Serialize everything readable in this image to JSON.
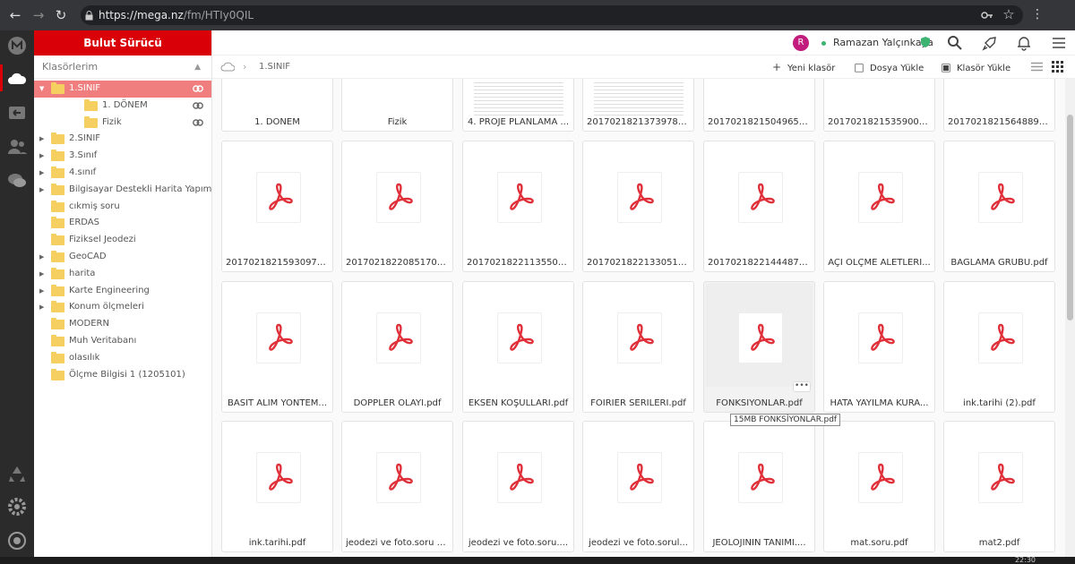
{
  "browser": {
    "url_host": "https://mega.nz",
    "url_path": "/fm/HTIy0QIL"
  },
  "sidebar": {
    "brand": "Bulut Sürücü",
    "tree_header": "Klasörlerim",
    "items": [
      {
        "label": "1.SINIF",
        "selected": true,
        "expanded": true,
        "level": 0,
        "has_link": true
      },
      {
        "label": "1. DÖNEM",
        "level": 1,
        "has_link": true
      },
      {
        "label": "Fizik",
        "level": 1,
        "has_link": true
      },
      {
        "label": "2.SINIF",
        "level": 0,
        "has_children": true
      },
      {
        "label": "3.Sınıf",
        "level": 0,
        "has_children": true
      },
      {
        "label": "4.sınıf",
        "level": 0,
        "has_children": true
      },
      {
        "label": "Bilgisayar Destekli Harita Yapımı",
        "level": 0,
        "has_children": true
      },
      {
        "label": "cıkmiş soru",
        "level": 0
      },
      {
        "label": "ERDAS",
        "level": 0
      },
      {
        "label": "Fiziksel Jeodezi",
        "level": 0
      },
      {
        "label": "GeoCAD",
        "level": 0,
        "has_children": true
      },
      {
        "label": "harita",
        "level": 0,
        "has_children": true
      },
      {
        "label": "Karte Engineering",
        "level": 0,
        "has_children": true
      },
      {
        "label": "Konum ölçmeleri",
        "level": 0,
        "has_children": true
      },
      {
        "label": "MODERN",
        "level": 0
      },
      {
        "label": "Muh Veritabanı",
        "level": 0
      },
      {
        "label": "olasılık",
        "level": 0
      },
      {
        "label": "Ölçme Bilgisi 1 (1205101)",
        "level": 0
      }
    ]
  },
  "topbar": {
    "avatar_letter": "R",
    "username": "Ramazan Yalçınkaya"
  },
  "toolbar": {
    "breadcrumb": "1.SINIF",
    "new_folder": "Yeni klasör",
    "upload_file": "Dosya Yükle",
    "upload_folder": "Klasör Yükle"
  },
  "files": {
    "row0": [
      "1. DÖNEM",
      "Fizik",
      "4. PROJE PLANLAMA ...",
      "20170218213739784....",
      "20170218215049651....",
      "20170218215359004....",
      "20170218215648893...."
    ],
    "row1": [
      "20170218215930975....",
      "20170218220851708....",
      "20170218221135500....",
      "20170218221330519....",
      "20170218221444874....",
      "AÇI ÖLÇME ALETLERİ...",
      "BAĞLAMA GRUBU.pdf"
    ],
    "row2": [
      "BASİT ALIM YÖNTEM...",
      "DOPPLER OLAYI.pdf",
      "EKSEN KOŞULLARI.pdf",
      "FOIRIER SERİLERİ.pdf",
      "FONKSİYONLAR.pdf",
      "HATA YAYILMA KURA...",
      "ink.tarihi (2).pdf"
    ],
    "row3": [
      "ink.tarihi.pdf",
      "jeodezi ve foto.soru (...",
      "jeodezi ve foto.soru....",
      "jeodezi ve foto.sorul...",
      "JEOLOJİNİN TANIMI....",
      "mat.soru.pdf",
      "mat2.pdf"
    ],
    "more_button": "•••",
    "tooltip": "15MB FONKSİYONLAR.pdf"
  },
  "colors": {
    "brand_red": "#d90007",
    "selected_row": "#f07e7e",
    "folder": "#f5cf5f",
    "pdf_red": "#e0313b"
  },
  "taskbar": {
    "clock": "22:30"
  }
}
